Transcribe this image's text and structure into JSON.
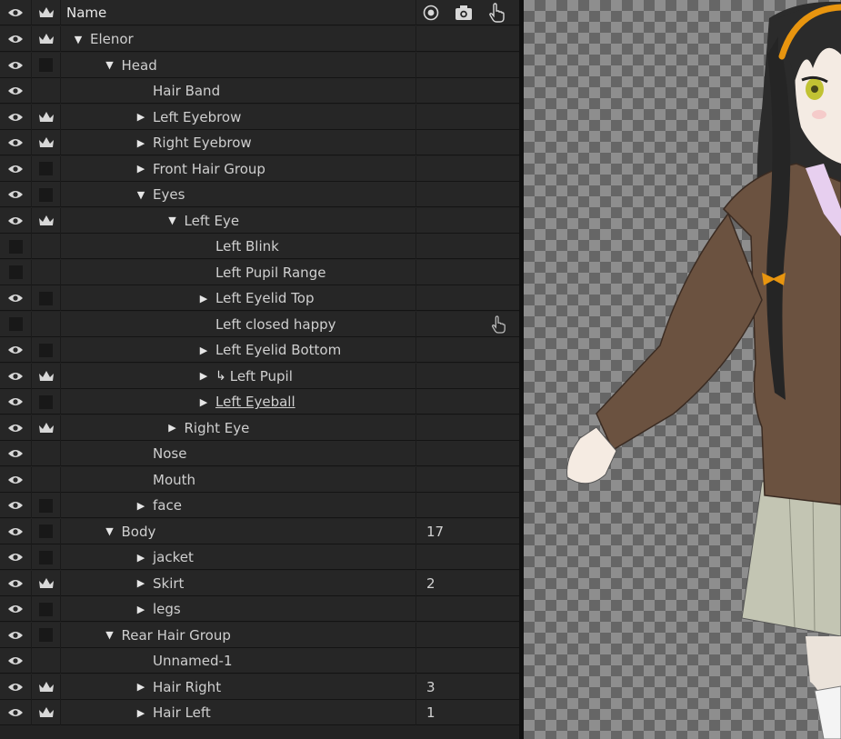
{
  "header": {
    "name_label": "Name"
  },
  "rows": [
    {
      "label": "Elenor",
      "arrow": "open",
      "eye": true,
      "crown": "crown",
      "count": "",
      "indent": 0
    },
    {
      "label": "Head",
      "arrow": "open",
      "eye": true,
      "crown": "box",
      "count": "",
      "indent": 1
    },
    {
      "label": "Hair Band",
      "arrow": "none",
      "eye": true,
      "crown": "none",
      "count": "",
      "indent": 2
    },
    {
      "label": "Left Eyebrow",
      "arrow": "closed",
      "eye": true,
      "crown": "crown",
      "count": "",
      "indent": 2
    },
    {
      "label": "Right Eyebrow",
      "arrow": "closed",
      "eye": true,
      "crown": "crown",
      "count": "",
      "indent": 2
    },
    {
      "label": "Front Hair Group",
      "arrow": "closed",
      "eye": true,
      "crown": "box",
      "count": "",
      "indent": 2
    },
    {
      "label": "Eyes",
      "arrow": "open",
      "eye": true,
      "crown": "box",
      "count": "",
      "indent": 2
    },
    {
      "label": "Left Eye",
      "arrow": "open",
      "eye": true,
      "crown": "crown",
      "count": "",
      "indent": 3
    },
    {
      "label": "Left Blink",
      "arrow": "none",
      "eye": false,
      "crown": "none",
      "count": "",
      "indent": 4
    },
    {
      "label": "Left Pupil Range",
      "arrow": "none",
      "eye": false,
      "crown": "none",
      "count": "",
      "indent": 4
    },
    {
      "label": "Left Eyelid Top",
      "arrow": "closed",
      "eye": true,
      "crown": "box",
      "count": "",
      "indent": 4
    },
    {
      "label": "Left closed happy",
      "arrow": "none",
      "eye": false,
      "crown": "none",
      "count": "",
      "indent": 4,
      "hand": true
    },
    {
      "label": "Left Eyelid Bottom",
      "arrow": "closed",
      "eye": true,
      "crown": "box",
      "count": "",
      "indent": 4
    },
    {
      "label": "Left Pupil",
      "arrow": "closed",
      "eye": true,
      "crown": "crown",
      "count": "",
      "indent": 4,
      "link": true
    },
    {
      "label": "Left Eyeball",
      "arrow": "closed",
      "eye": true,
      "crown": "box",
      "count": "",
      "indent": 4,
      "underline": true
    },
    {
      "label": "Right Eye",
      "arrow": "closed",
      "eye": true,
      "crown": "crown",
      "count": "",
      "indent": 3
    },
    {
      "label": "Nose",
      "arrow": "none",
      "eye": true,
      "crown": "none",
      "count": "",
      "indent": 2
    },
    {
      "label": "Mouth",
      "arrow": "none",
      "eye": true,
      "crown": "none",
      "count": "",
      "indent": 2
    },
    {
      "label": "face",
      "arrow": "closed",
      "eye": true,
      "crown": "box",
      "count": "",
      "indent": 2
    },
    {
      "label": "Body",
      "arrow": "open",
      "eye": true,
      "crown": "box",
      "count": "17",
      "indent": 1
    },
    {
      "label": "jacket",
      "arrow": "closed",
      "eye": true,
      "crown": "box",
      "count": "",
      "indent": 2
    },
    {
      "label": "Skirt",
      "arrow": "closed",
      "eye": true,
      "crown": "crown",
      "count": "2",
      "indent": 2
    },
    {
      "label": "legs",
      "arrow": "closed",
      "eye": true,
      "crown": "box",
      "count": "",
      "indent": 2
    },
    {
      "label": "Rear Hair Group",
      "arrow": "open",
      "eye": true,
      "crown": "box",
      "count": "",
      "indent": 1
    },
    {
      "label": "Unnamed-1",
      "arrow": "none",
      "eye": true,
      "crown": "none",
      "count": "",
      "indent": 2
    },
    {
      "label": "Hair Right",
      "arrow": "closed",
      "eye": true,
      "crown": "crown",
      "count": "3",
      "indent": 2
    },
    {
      "label": "Hair Left",
      "arrow": "closed",
      "eye": true,
      "crown": "crown",
      "count": "1",
      "indent": 2
    }
  ],
  "colors": {
    "panel": "#262626",
    "accent_hairband": "#e8950f",
    "jacket": "#6b5240",
    "skirt": "#c3c5b3"
  },
  "icons": {
    "eye": "eye-icon",
    "crown": "crown-icon",
    "target": "target-icon",
    "camera": "camera-icon",
    "hand": "hand-pointer-icon"
  }
}
